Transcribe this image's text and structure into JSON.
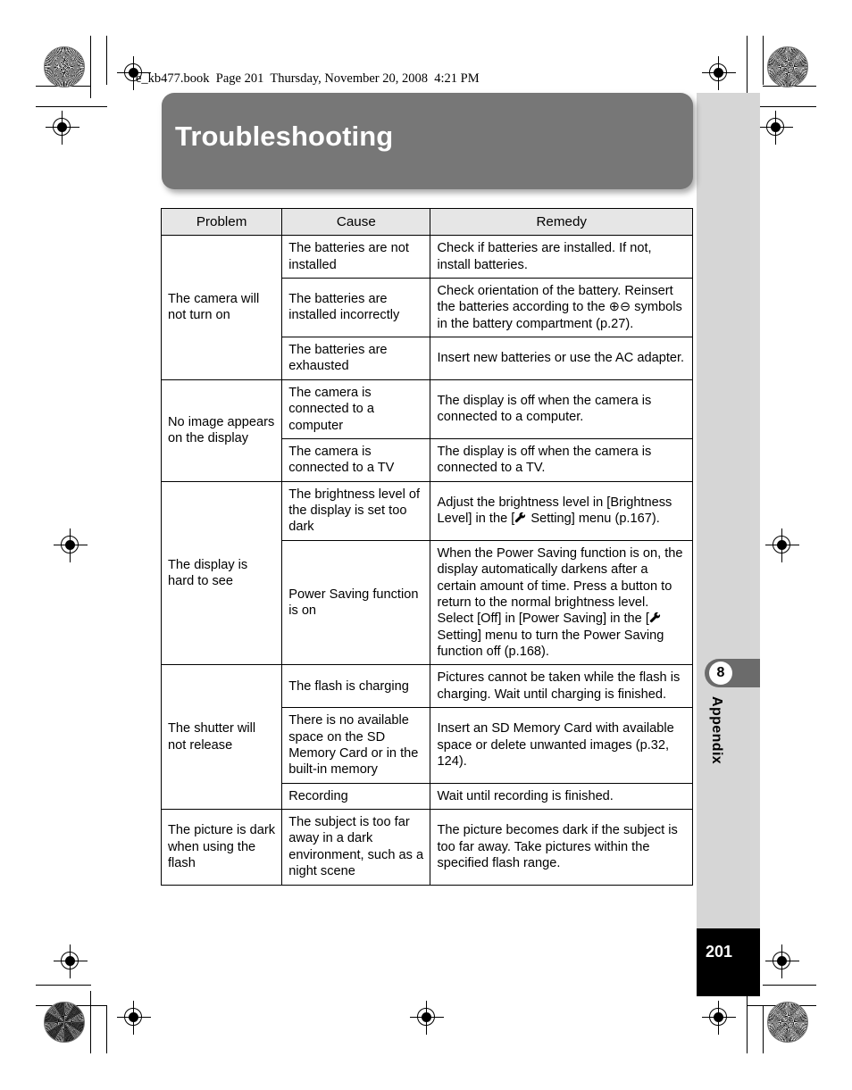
{
  "running_header": "e_kb477.book  Page 201  Thursday, November 20, 2008  4:21 PM",
  "banner": {
    "title": "Troubleshooting"
  },
  "sidebar": {
    "chapter_number": "8",
    "chapter_label": "Appendix",
    "page_number": "201",
    "band_color": "#d6d6d6",
    "tab_color": "#6b6b6b",
    "page_block_color": "#000000"
  },
  "table": {
    "headers": [
      "Problem",
      "Cause",
      "Remedy"
    ],
    "rows": [
      {
        "problem": "The camera will not turn on",
        "problem_rowspan": 3,
        "cause": "The batteries are not installed",
        "remedy": "Check if batteries are installed. If not, install batteries."
      },
      {
        "cause": "The batteries are installed incorrectly",
        "remedy_pre": "Check orientation of the battery. Reinsert the batteries according to the ",
        "remedy_sym1": "⊕",
        "remedy_sym2": "⊖",
        "remedy_post": " symbols in the battery compartment (p.27)."
      },
      {
        "cause": "The batteries are exhausted",
        "remedy": "Insert new batteries or use the AC adapter."
      },
      {
        "problem": "No image appears on the display",
        "problem_rowspan": 2,
        "cause": "The camera is connected to a computer",
        "remedy": "The display is off when the camera is connected to a computer."
      },
      {
        "cause": "The camera is connected to a TV",
        "remedy": "The display is off when the camera is connected to a TV."
      },
      {
        "problem": "The display is hard to see",
        "problem_rowspan": 2,
        "cause": "The brightness level of the display is set too dark",
        "remedy_pre": "Adjust the brightness level in [Brightness Level] in the [",
        "remedy_icon": "wrench-icon",
        "remedy_post": " Setting] menu (p.167)."
      },
      {
        "cause": "Power Saving function is on",
        "remedy_pre": "When the Power Saving function is on, the display automatically darkens after a certain amount of time. Press a button to return to the normal brightness level. Select [Off] in [Power Saving] in the [",
        "remedy_icon": "wrench-icon",
        "remedy_post": " Setting] menu to turn the Power Saving function off (p.168)."
      },
      {
        "problem": "The shutter will not release",
        "problem_rowspan": 3,
        "cause": "The flash is charging",
        "remedy": "Pictures cannot be taken while the flash is charging. Wait until charging is finished."
      },
      {
        "cause": "There is no available space on the SD Memory Card or in the built-in memory",
        "remedy": "Insert an SD Memory Card with available space or delete unwanted images (p.32, 124)."
      },
      {
        "cause": "Recording",
        "remedy": "Wait until recording is finished."
      },
      {
        "problem": "The picture is dark when using the flash",
        "problem_rowspan": 1,
        "cause": "The subject is too far away in a dark environment, such as a night scene",
        "remedy": "The picture becomes dark if the subject is too far away. Take pictures within the specified flash range."
      }
    ]
  }
}
